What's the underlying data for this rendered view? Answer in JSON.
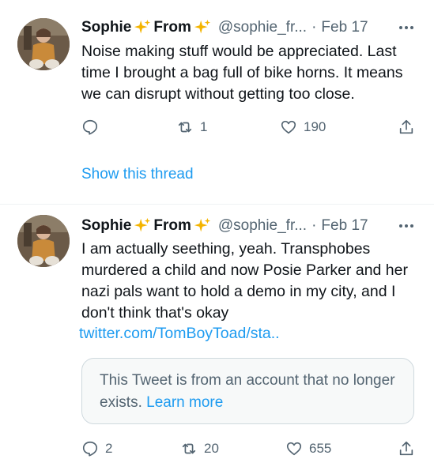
{
  "tweets": [
    {
      "name": "Sophie",
      "name_suffix": "From",
      "handle": "@sophie_fr...",
      "separator": "·",
      "date": "Feb 17",
      "text": "Noise making stuff would be appreciated. Last time I brought a bag full of bike horns. It means we can disrupt without getting too close.",
      "replies": "",
      "retweets": "1",
      "likes": "190",
      "show_thread": "Show this thread"
    },
    {
      "name": "Sophie",
      "name_suffix": "From",
      "handle": "@sophie_fr...",
      "separator": "·",
      "date": "Feb 17",
      "text": "I am actually seething, yeah. Transphobes murdered a child and now Posie Parker and her nazi pals want to hold a demo in my city, and I don't think that's okay",
      "link": "twitter.com/TomBoyToad/sta..",
      "quote_text": "This Tweet is from an account that no longer exists.",
      "quote_link": "Learn more",
      "replies": "2",
      "retweets": "20",
      "likes": "655"
    }
  ],
  "colors": {
    "accent": "#1d9bf0",
    "muted": "#536471",
    "sparkle": "#f4b400"
  },
  "icons": [
    "reply-icon",
    "retweet-icon",
    "like-icon",
    "share-icon",
    "more-icon",
    "sparkle-icon"
  ]
}
